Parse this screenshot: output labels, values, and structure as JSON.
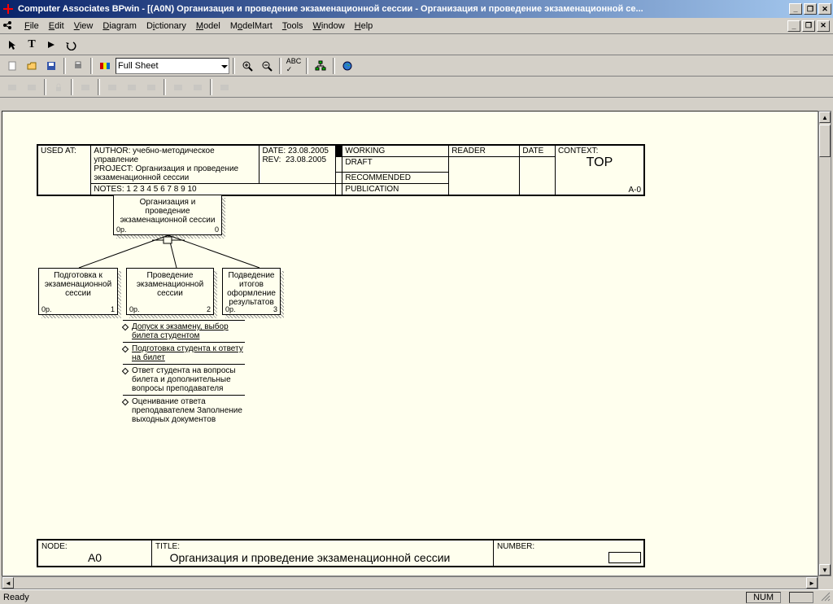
{
  "titlebar": {
    "title": "Computer Associates BPwin - [(A0N) Организация и проведение  экзаменационной сессии   - Организация и проведение экзаменационной се..."
  },
  "menu": {
    "file": "File",
    "edit": "Edit",
    "view": "View",
    "diagram": "Diagram",
    "dictionary": "Dictionary",
    "model": "Model",
    "modelmart": "ModelMart",
    "tools": "Tools",
    "window": "Window",
    "help": "Help"
  },
  "toolbar": {
    "zoom": "Full Sheet"
  },
  "header": {
    "used_at_label": "USED AT:",
    "author_label": "AUTHOR:",
    "author": "учебно-методическое управление",
    "project_label": "PROJECT:",
    "project": "Организация и проведение экзаменационной сессии",
    "notes_label": "NOTES:",
    "notes": "1  2  3  4  5  6  7  8  9  10",
    "date_label": "DATE:",
    "date": "23.08.2005",
    "rev_label": "REV:",
    "rev": "23.08.2005",
    "working": "WORKING",
    "draft": "DRAFT",
    "recommended": "RECOMMENDED",
    "publication": "PUBLICATION",
    "reader": "READER",
    "hdate": "DATE",
    "context_label": "CONTEXT:",
    "context": "TOP",
    "a0": "A-0"
  },
  "tree": {
    "root": {
      "title": "Организация и проведение экзаменационной сессии",
      "op": "0p.",
      "num": "0"
    },
    "children": [
      {
        "title": "Подготовка к экзаменационной сессии",
        "op": "0p.",
        "num": "1"
      },
      {
        "title": "Проведение экзаменационной сессии",
        "op": "0p.",
        "num": "2"
      },
      {
        "title": "Подведение итогов оформление результатов",
        "op": "0p.",
        "num": "3"
      }
    ],
    "subitems": [
      "Допуск к экзамену, выбор билета студентом",
      "Подготовка студента к ответу  на билет",
      "Ответ студента на вопросы билета и дополнительные вопросы преподавателя",
      "Оценивание ответа преподавателем Заполнение выходных документов"
    ]
  },
  "footer": {
    "node_label": "NODE:",
    "node": "A0",
    "title_label": "TITLE:",
    "title": "Организация и проведение  экзаменационной сессии",
    "number_label": "NUMBER:"
  },
  "status": {
    "ready": "Ready",
    "num": "NUM"
  }
}
